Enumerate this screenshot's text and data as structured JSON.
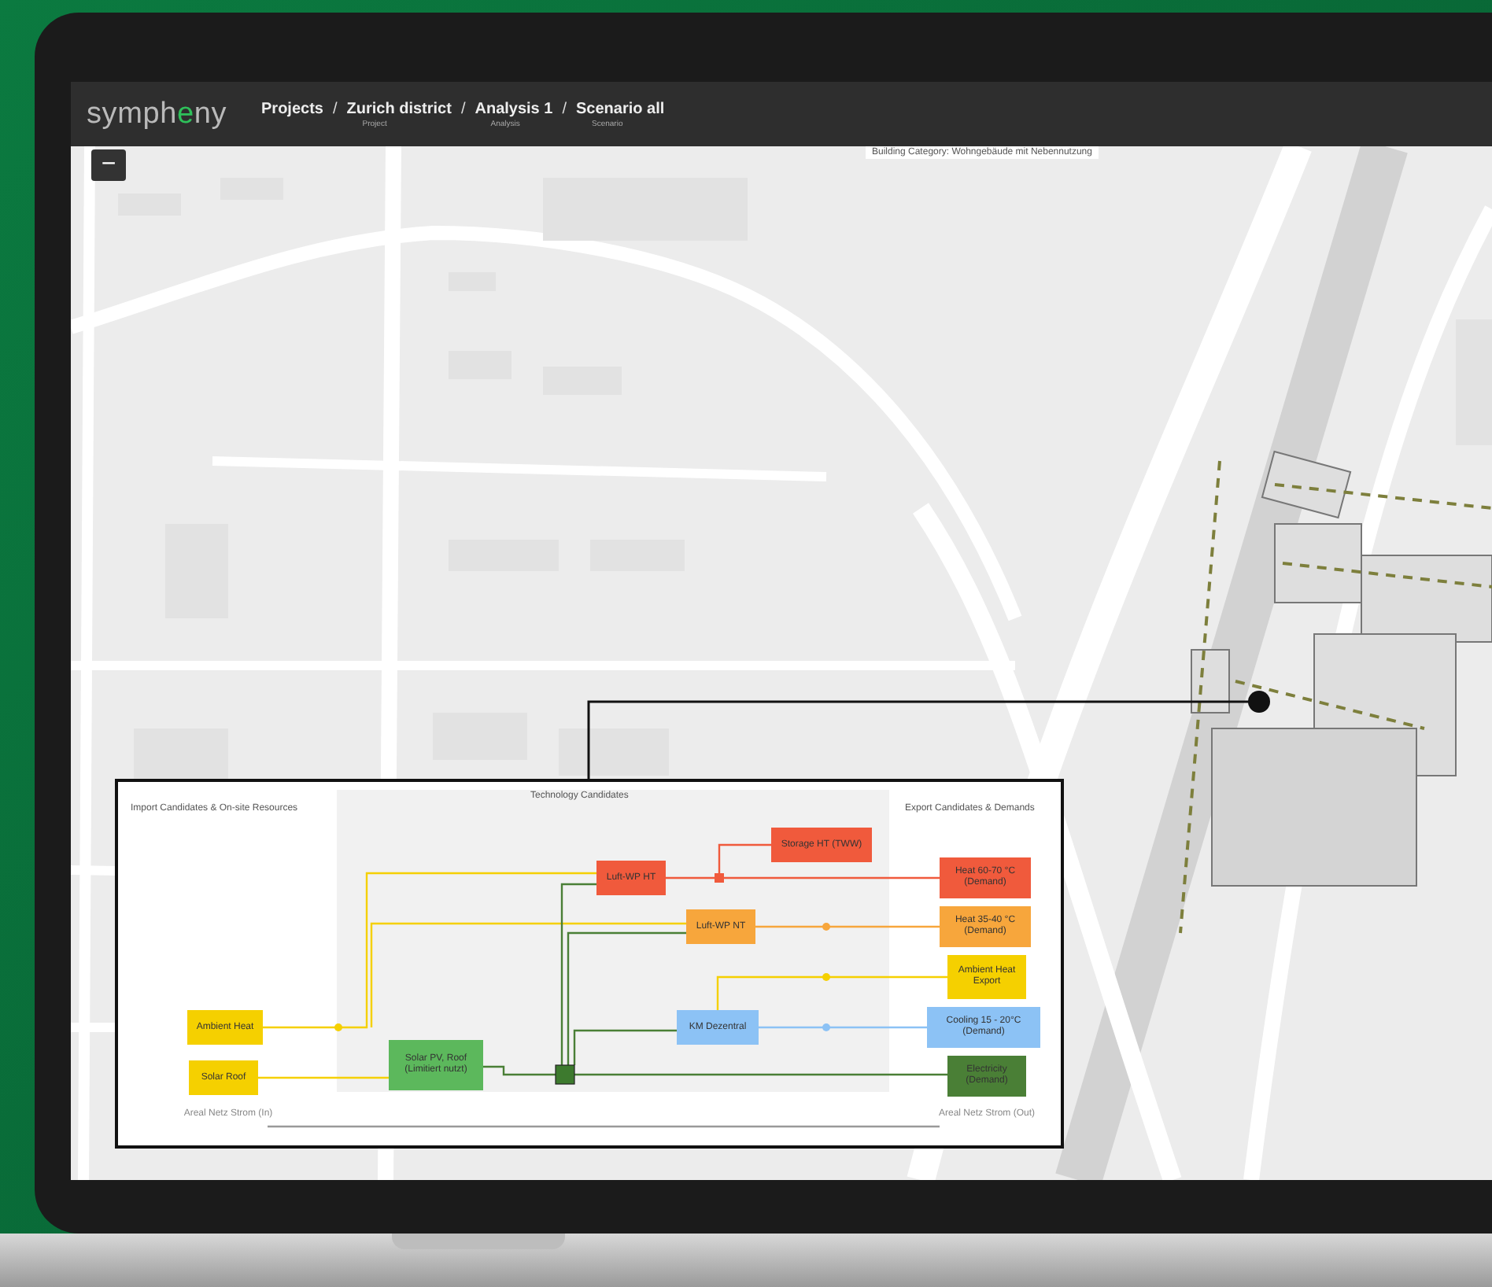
{
  "header": {
    "logo": {
      "before": "symph",
      "accent": "e",
      "after": "ny"
    },
    "separator": "/",
    "breadcrumbs": [
      {
        "label": "Projects"
      },
      {
        "label": "Zurich district",
        "sublabel": "Project"
      },
      {
        "label": "Analysis 1",
        "sublabel": "Analysis"
      },
      {
        "label": "Scenario all",
        "sublabel": "Scenario"
      }
    ]
  },
  "map": {
    "zoom_out_button": "−",
    "popup_text": "Building Category: Wohngebäude mit Nebennutzung"
  },
  "diagram": {
    "sections": [
      "Import Candidates & On-site Resources",
      "Technology Candidates",
      "Export Candidates & Demands"
    ],
    "nodes": [
      {
        "label": "Ambient Heat",
        "color": "#f5d000"
      },
      {
        "label": "Solar Roof",
        "color": "#f5d000"
      },
      {
        "label": "Solar PV, Roof (Limitiert nutzt)",
        "color": "#5cb85c"
      },
      {
        "label": "Luft-WP HT",
        "color": "#f05a3c"
      },
      {
        "label": "Storage HT (TWW)",
        "color": "#f05a3c"
      },
      {
        "label": "Heat 60-70 °C (Demand)",
        "color": "#f05a3c"
      },
      {
        "label": "Luft-WP NT",
        "color": "#f7a63c"
      },
      {
        "label": "Heat 35-40 °C (Demand)",
        "color": "#f7a63c"
      },
      {
        "label": "Ambient Heat Export",
        "color": "#f5d000"
      },
      {
        "label": "KM Dezentral",
        "color": "#8cc2f5"
      },
      {
        "label": "Cooling 15 - 20°C (Demand)",
        "color": "#8cc2f5"
      },
      {
        "label": "Electricity (Demand)",
        "color": "#4a7f36"
      }
    ],
    "grid_labels": [
      "Areal Netz Strom (In)",
      "Areal Netz Strom (Out)"
    ]
  }
}
